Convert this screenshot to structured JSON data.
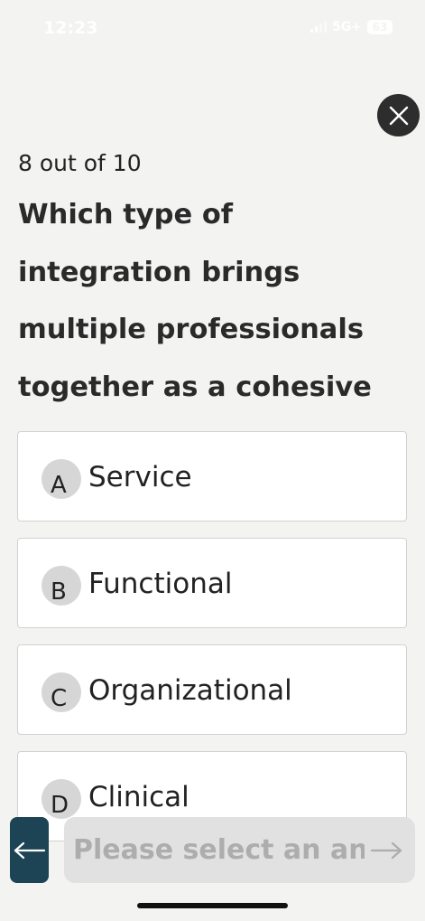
{
  "status_bar": {
    "time": "12:23",
    "network": "5G+",
    "battery": "63"
  },
  "quiz": {
    "progress": "8 out of 10",
    "question": "Which type of integration brings multiple professionals together as a cohesive service unit?",
    "options": [
      {
        "letter": "A",
        "text": "Service"
      },
      {
        "letter": "B",
        "text": "Functional"
      },
      {
        "letter": "C",
        "text": "Organizational"
      },
      {
        "letter": "D",
        "text": "Clinical"
      }
    ]
  },
  "footer": {
    "next_label": "Please select an answer"
  },
  "icons": {
    "close": "close-icon",
    "back": "arrow-left-icon",
    "next": "arrow-right-icon"
  },
  "colors": {
    "background": "#f3f3f2",
    "close_button": "#2d2d2d",
    "back_button": "#1c4454",
    "next_button_disabled": "#e1e1e1",
    "next_text_disabled": "#adadad",
    "option_border": "#d2d2d2",
    "option_badge": "#d6d6d6"
  }
}
